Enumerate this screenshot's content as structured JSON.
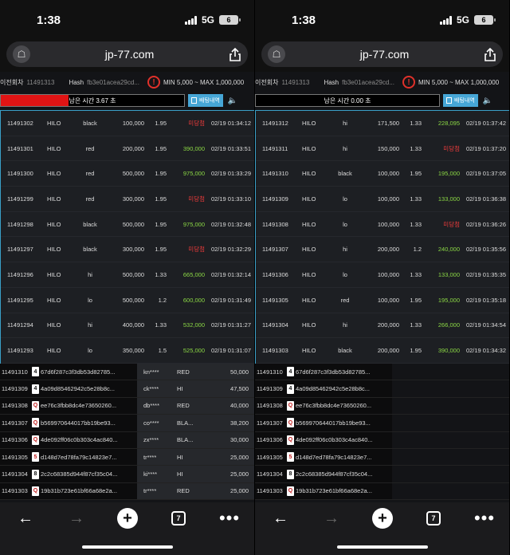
{
  "phones": [
    {
      "status": {
        "time": "1:38",
        "network": "5G",
        "battery": "6"
      },
      "url": "jp-77.com",
      "round": {
        "label": "이전회차",
        "number": "11491313",
        "hash_label": "Hash",
        "hash": "fb3e01acea29cd...",
        "limits": "MIN 5,000 ~ MAX 1,000,000"
      },
      "timer": {
        "text": "남은 시간 3.67 초",
        "fill_fraction": 0.37
      },
      "history_button": "배팅내역",
      "bets": [
        {
          "round": "11491302",
          "game": "HILO",
          "pick": "black",
          "amount": "100,000",
          "odds": "1.95",
          "result": "미당첨",
          "win": false,
          "time": "02/19 01:34:12"
        },
        {
          "round": "11491301",
          "game": "HILO",
          "pick": "red",
          "amount": "200,000",
          "odds": "1.95",
          "result": "390,000",
          "win": true,
          "time": "02/19 01:33:51"
        },
        {
          "round": "11491300",
          "game": "HILO",
          "pick": "red",
          "amount": "500,000",
          "odds": "1.95",
          "result": "975,000",
          "win": true,
          "time": "02/19 01:33:29"
        },
        {
          "round": "11491299",
          "game": "HILO",
          "pick": "red",
          "amount": "300,000",
          "odds": "1.95",
          "result": "미당첨",
          "win": false,
          "time": "02/19 01:33:10"
        },
        {
          "round": "11491298",
          "game": "HILO",
          "pick": "black",
          "amount": "500,000",
          "odds": "1.95",
          "result": "975,000",
          "win": true,
          "time": "02/19 01:32:48"
        },
        {
          "round": "11491297",
          "game": "HILO",
          "pick": "black",
          "amount": "300,000",
          "odds": "1.95",
          "result": "미당첨",
          "win": false,
          "time": "02/19 01:32:29"
        },
        {
          "round": "11491296",
          "game": "HILO",
          "pick": "hi",
          "amount": "500,000",
          "odds": "1.33",
          "result": "665,000",
          "win": true,
          "time": "02/19 01:32:14"
        },
        {
          "round": "11491295",
          "game": "HILO",
          "pick": "lo",
          "amount": "500,000",
          "odds": "1.2",
          "result": "600,000",
          "win": true,
          "time": "02/19 01:31:49"
        },
        {
          "round": "11491294",
          "game": "HILO",
          "pick": "hi",
          "amount": "400,000",
          "odds": "1.33",
          "result": "532,000",
          "win": true,
          "time": "02/19 01:31:27"
        },
        {
          "round": "11491293",
          "game": "HILO",
          "pick": "lo",
          "amount": "350,000",
          "odds": "1.5",
          "result": "525,000",
          "win": true,
          "time": "02/19 01:31:07"
        }
      ],
      "results": [
        {
          "round": "11491310",
          "card": "4",
          "card_color": "black",
          "hash": "67d6f287c3f3db53d82785...",
          "user": "kn****",
          "pick": "RED",
          "amount": "50,000"
        },
        {
          "round": "11491309",
          "card": "4",
          "card_color": "black",
          "hash": "4a09d85462942c5e28b8c...",
          "user": "ck****",
          "pick": "HI",
          "amount": "47,500"
        },
        {
          "round": "11491308",
          "card": "Q",
          "card_color": "red",
          "hash": "ee76c3fbb8dc4e73650260...",
          "user": "db****",
          "pick": "RED",
          "amount": "40,000"
        },
        {
          "round": "11491307",
          "card": "Q",
          "card_color": "red",
          "hash": "b569970644017bb19be93...",
          "user": "co****",
          "pick": "BLA...",
          "amount": "38,200"
        },
        {
          "round": "11491306",
          "card": "Q",
          "card_color": "red",
          "hash": "4de092ff06c0b303c4ac840...",
          "user": "zx****",
          "pick": "BLA...",
          "amount": "30,000"
        },
        {
          "round": "11491305",
          "card": "5",
          "card_color": "red",
          "hash": "d148d7ed78fa79c14823e7...",
          "user": "tr****",
          "pick": "HI",
          "amount": "25,000"
        },
        {
          "round": "11491304",
          "card": "8",
          "card_color": "black",
          "hash": "2c2c68385d944f87cf35c04...",
          "user": "ki****",
          "pick": "HI",
          "amount": "25,000"
        },
        {
          "round": "11491303",
          "card": "Q",
          "card_color": "red",
          "hash": "19b31b723e61bf66a68e2a...",
          "user": "tr****",
          "pick": "RED",
          "amount": "25,000"
        }
      ],
      "nav": {
        "tabs_count": "7"
      }
    },
    {
      "status": {
        "time": "1:38",
        "network": "5G",
        "battery": "6"
      },
      "url": "jp-77.com",
      "round": {
        "label": "이전회차",
        "number": "11491313",
        "hash_label": "Hash",
        "hash": "fb3e01acea29cd...",
        "limits": "MIN 5,000 ~ MAX 1,000,000"
      },
      "timer": {
        "text": "남은 시간 0.00 초",
        "fill_fraction": 0
      },
      "history_button": "배팅내역",
      "bets": [
        {
          "round": "11491312",
          "game": "HILO",
          "pick": "hi",
          "amount": "171,500",
          "odds": "1.33",
          "result": "228,095",
          "win": true,
          "time": "02/19 01:37:42"
        },
        {
          "round": "11491311",
          "game": "HILO",
          "pick": "hi",
          "amount": "150,000",
          "odds": "1.33",
          "result": "미당첨",
          "win": false,
          "time": "02/19 01:37:20"
        },
        {
          "round": "11491310",
          "game": "HILO",
          "pick": "black",
          "amount": "100,000",
          "odds": "1.95",
          "result": "195,000",
          "win": true,
          "time": "02/19 01:37:05"
        },
        {
          "round": "11491309",
          "game": "HILO",
          "pick": "lo",
          "amount": "100,000",
          "odds": "1.33",
          "result": "133,000",
          "win": true,
          "time": "02/19 01:36:38"
        },
        {
          "round": "11491308",
          "game": "HILO",
          "pick": "lo",
          "amount": "100,000",
          "odds": "1.33",
          "result": "미당첨",
          "win": false,
          "time": "02/19 01:36:26"
        },
        {
          "round": "11491307",
          "game": "HILO",
          "pick": "hi",
          "amount": "200,000",
          "odds": "1.2",
          "result": "240,000",
          "win": true,
          "time": "02/19 01:35:56"
        },
        {
          "round": "11491306",
          "game": "HILO",
          "pick": "lo",
          "amount": "100,000",
          "odds": "1.33",
          "result": "133,000",
          "win": true,
          "time": "02/19 01:35:35"
        },
        {
          "round": "11491305",
          "game": "HILO",
          "pick": "red",
          "amount": "100,000",
          "odds": "1.95",
          "result": "195,000",
          "win": true,
          "time": "02/19 01:35:18"
        },
        {
          "round": "11491304",
          "game": "HILO",
          "pick": "hi",
          "amount": "200,000",
          "odds": "1.33",
          "result": "266,000",
          "win": true,
          "time": "02/19 01:34:54"
        },
        {
          "round": "11491303",
          "game": "HILO",
          "pick": "black",
          "amount": "200,000",
          "odds": "1.95",
          "result": "390,000",
          "win": true,
          "time": "02/19 01:34:32"
        }
      ],
      "results": [
        {
          "round": "11491310",
          "card": "4",
          "card_color": "black",
          "hash": "67d6f287c3f3db53d82785...",
          "user": "",
          "pick": "",
          "amount": ""
        },
        {
          "round": "11491309",
          "card": "4",
          "card_color": "black",
          "hash": "4a09d85462942c5e28b8c...",
          "user": "",
          "pick": "",
          "amount": ""
        },
        {
          "round": "11491308",
          "card": "Q",
          "card_color": "red",
          "hash": "ee76c3fbb8dc4e73650260...",
          "user": "",
          "pick": "",
          "amount": ""
        },
        {
          "round": "11491307",
          "card": "Q",
          "card_color": "red",
          "hash": "b569970644017bb19be93...",
          "user": "",
          "pick": "",
          "amount": ""
        },
        {
          "round": "11491306",
          "card": "Q",
          "card_color": "red",
          "hash": "4de092ff06c0b303c4ac840...",
          "user": "",
          "pick": "",
          "amount": ""
        },
        {
          "round": "11491305",
          "card": "5",
          "card_color": "red",
          "hash": "d148d7ed78fa79c14823e7...",
          "user": "",
          "pick": "",
          "amount": ""
        },
        {
          "round": "11491304",
          "card": "8",
          "card_color": "black",
          "hash": "2c2c68385d944f87cf35c04...",
          "user": "",
          "pick": "",
          "amount": ""
        },
        {
          "round": "11491303",
          "card": "Q",
          "card_color": "red",
          "hash": "19b31b723e61bf66a68e2a...",
          "user": "",
          "pick": "",
          "amount": ""
        }
      ],
      "nav": {
        "tabs_count": "7"
      }
    }
  ],
  "colors": {
    "win": "#8bd845",
    "lose": "#ef3b3b",
    "accent": "#3aa0c8",
    "timer_fill": "#e01414"
  }
}
